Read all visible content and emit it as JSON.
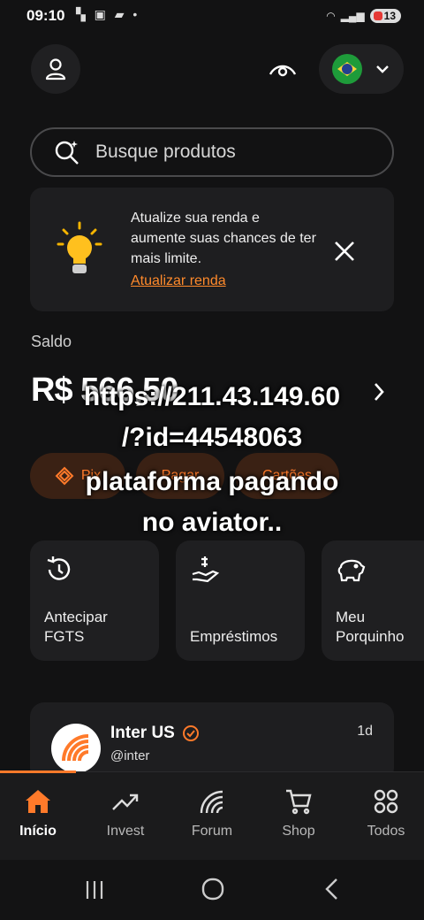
{
  "status_bar": {
    "time": "09:10",
    "battery": "13"
  },
  "search": {
    "placeholder": "Busque produtos"
  },
  "banner": {
    "text": "Atualize sua renda e aumente suas chances de ter mais limite.",
    "link": "Atualizar renda"
  },
  "saldo": {
    "label": "Saldo",
    "value": "R$ 566,50"
  },
  "actions": [
    {
      "label": "Pix",
      "icon": "pix-icon"
    },
    {
      "label": "Pagar",
      "icon": "barcode-icon"
    },
    {
      "label": "Cartões",
      "icon": "card-icon"
    }
  ],
  "overlay_text": [
    "https://211.43.149.60",
    "/?id=44548063",
    "plataforma pagando",
    "no aviator.."
  ],
  "cards": [
    {
      "label_line1": "Antecipar",
      "label_line2": "FGTS",
      "icon": "history-icon"
    },
    {
      "label_line1": "Empréstimos",
      "label_line2": "",
      "icon": "money-hand-icon"
    },
    {
      "label_line1": "Meu",
      "label_line2": "Porquinho",
      "icon": "piggy-bank-icon"
    }
  ],
  "post": {
    "name": "Inter US",
    "handle": "@inter",
    "time": "1d"
  },
  "bottom_nav": [
    {
      "label": "Início",
      "icon": "home-icon",
      "active": true
    },
    {
      "label": "Invest",
      "icon": "trending-up-icon",
      "active": false
    },
    {
      "label": "Forum",
      "icon": "forum-icon",
      "active": false
    },
    {
      "label": "Shop",
      "icon": "cart-icon",
      "active": false
    },
    {
      "label": "Todos",
      "icon": "grid-icon",
      "active": false
    }
  ],
  "colors": {
    "accent": "#ff7a2a",
    "background": "#121213",
    "card": "#1f1f21"
  }
}
